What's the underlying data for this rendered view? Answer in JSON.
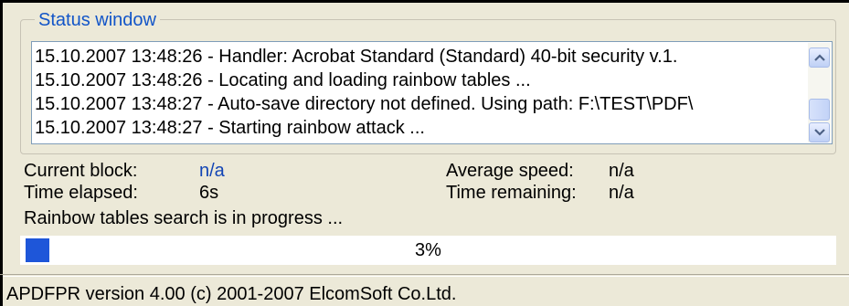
{
  "status_window": {
    "title": "Status window",
    "log": [
      "15.10.2007 13:48:26 - Handler: Acrobat Standard (Standard) 40-bit security v.1.",
      "15.10.2007 13:48:26 - Locating and loading rainbow tables ...",
      "15.10.2007 13:48:27 - Auto-save directory not defined. Using path: F:\\TEST\\PDF\\",
      "15.10.2007 13:48:27 - Starting rainbow attack ..."
    ]
  },
  "stats": {
    "current_block_label": "Current block:",
    "current_block_value": "n/a",
    "time_elapsed_label": "Time elapsed:",
    "time_elapsed_value": "6s",
    "average_speed_label": "Average speed:",
    "average_speed_value": "n/a",
    "time_remaining_label": "Time remaining:",
    "time_remaining_value": "n/a",
    "progress_message": "Rainbow tables search is in progress ..."
  },
  "progress": {
    "percent": 3,
    "label": "3%"
  },
  "statusbar": {
    "text": "APDFPR version 4.00 (c) 2001-2007 ElcomSoft Co.Ltd."
  },
  "colors": {
    "accent_title": "#1255c8",
    "progress_fill": "#1e56d9",
    "value_blue": "#1245b5"
  }
}
